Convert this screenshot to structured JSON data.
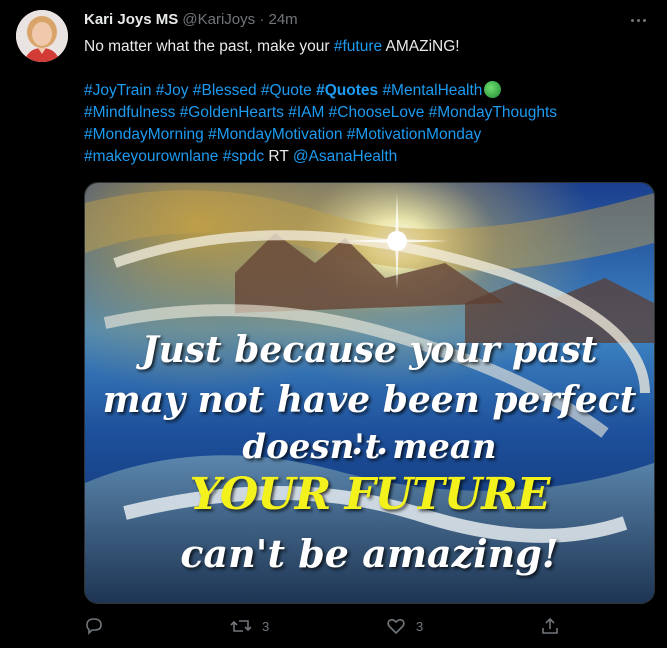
{
  "author": {
    "name": "Kari Joys MS",
    "handle": "@KariJoys",
    "separator": "·",
    "time": "24m"
  },
  "text": {
    "line1_before": "No matter what the past, make your ",
    "line1_tag": "#future",
    "line1_after": " AMAZiNG!",
    "line3": [
      "#JoyTrain",
      "#Joy",
      "#Blessed",
      "#Quote"
    ],
    "line3_bold": "#Quotes",
    "line3_end": "#MentalHealth",
    "emoji": "globe-emoji",
    "line4": "#Mindfulness #GoldenHearts #IAM #ChooseLove #MondayThoughts",
    "line5": "#MondayMorning #MondayMotivation #MotivationMonday",
    "line6_tags": "#makeyourownlane #spdc",
    "line6_rt": " RT ",
    "line6_mention": "@AsanaHealth"
  },
  "media": {
    "lines": [
      "Just because your past",
      "may not have been perfect ...",
      "doesn't mean",
      "YOUR FUTURE",
      "can't be amazing!"
    ],
    "highlight_color": "#f4f21c"
  },
  "actions": {
    "reply_count": "",
    "retweet_count": "3",
    "like_count": "3",
    "share_count": ""
  },
  "colors": {
    "background": "#000000",
    "accent": "#1d9bf0",
    "muted": "#71767b",
    "text": "#e7e9ea"
  }
}
